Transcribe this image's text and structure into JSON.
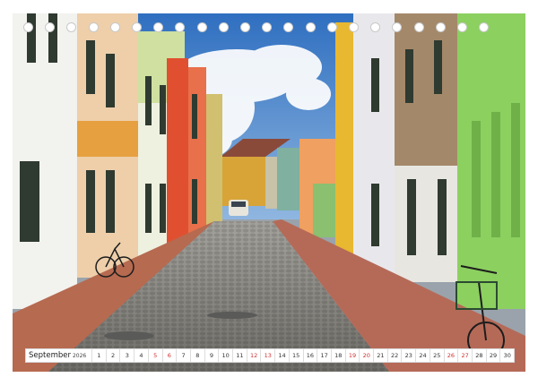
{
  "calendar": {
    "month": "September",
    "year": "2026",
    "days": [
      {
        "n": "1",
        "w": false
      },
      {
        "n": "2",
        "w": false
      },
      {
        "n": "3",
        "w": false
      },
      {
        "n": "4",
        "w": false
      },
      {
        "n": "5",
        "w": true
      },
      {
        "n": "6",
        "w": true
      },
      {
        "n": "7",
        "w": false
      },
      {
        "n": "8",
        "w": false
      },
      {
        "n": "9",
        "w": false
      },
      {
        "n": "10",
        "w": false
      },
      {
        "n": "11",
        "w": false
      },
      {
        "n": "12",
        "w": true
      },
      {
        "n": "13",
        "w": true
      },
      {
        "n": "14",
        "w": false
      },
      {
        "n": "15",
        "w": false
      },
      {
        "n": "16",
        "w": false
      },
      {
        "n": "17",
        "w": false
      },
      {
        "n": "18",
        "w": false
      },
      {
        "n": "19",
        "w": true
      },
      {
        "n": "20",
        "w": true
      },
      {
        "n": "21",
        "w": false
      },
      {
        "n": "22",
        "w": false
      },
      {
        "n": "23",
        "w": false
      },
      {
        "n": "24",
        "w": false
      },
      {
        "n": "25",
        "w": false
      },
      {
        "n": "26",
        "w": true
      },
      {
        "n": "27",
        "w": true
      },
      {
        "n": "28",
        "w": false
      },
      {
        "n": "29",
        "w": false
      },
      {
        "n": "30",
        "w": false
      }
    ],
    "weekend_color": "#d03030"
  },
  "photo": {
    "subject": "cobblestone-street-colorful-houses",
    "sky_color": "#3f7fc8",
    "road_color": "#8c8c8a"
  },
  "binding": {
    "hole_count": 22
  }
}
